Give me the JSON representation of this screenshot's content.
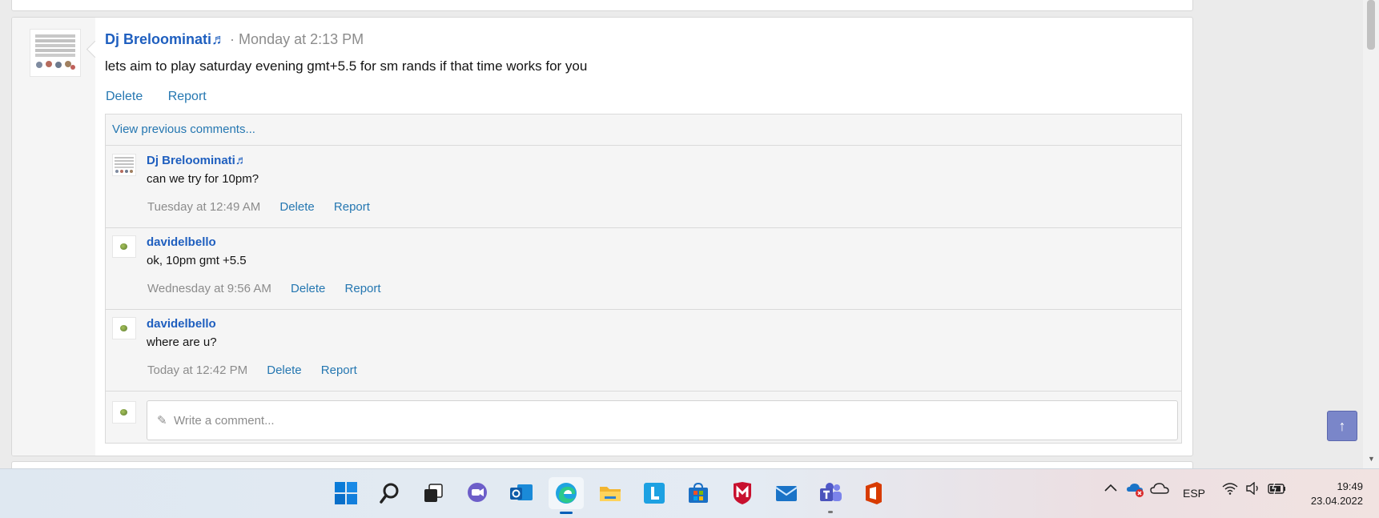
{
  "post": {
    "author": "Dj Breloominati♬",
    "separator": "·",
    "time": "Monday at 2:13 PM",
    "body": "lets aim to play saturday evening gmt+5.5 for sm rands if that time works for you",
    "actions": {
      "delete": "Delete",
      "report": "Report"
    }
  },
  "comments": {
    "view_previous": "View previous comments...",
    "items": [
      {
        "author": "Dj Breloominati♬",
        "text": "can we try for 10pm?",
        "time": "Tuesday at 12:49 AM",
        "delete": "Delete",
        "report": "Report"
      },
      {
        "author": "davidelbello",
        "text": "ok, 10pm gmt +5.5",
        "time": "Wednesday at 9:56 AM",
        "delete": "Delete",
        "report": "Report"
      },
      {
        "author": "davidelbello",
        "text": "where are u?",
        "time": "Today at 12:42 PM",
        "delete": "Delete",
        "report": "Report"
      }
    ],
    "write_placeholder": "Write a comment..."
  },
  "taskbar": {
    "icons": [
      "windows-start-icon",
      "search-icon",
      "task-view-icon",
      "chat-icon",
      "outlook-icon",
      "edge-icon",
      "file-explorer-icon",
      "l-app-icon",
      "store-icon",
      "mcafee-icon",
      "mail-icon",
      "teams-icon",
      "office-icon"
    ],
    "tray": {
      "language": "ESP"
    },
    "clock": {
      "time": "19:49",
      "date": "23.04.2022"
    }
  },
  "colors": {
    "link": "#2577b1",
    "author": "#1f5fbf",
    "muted": "#8c8c8c"
  }
}
